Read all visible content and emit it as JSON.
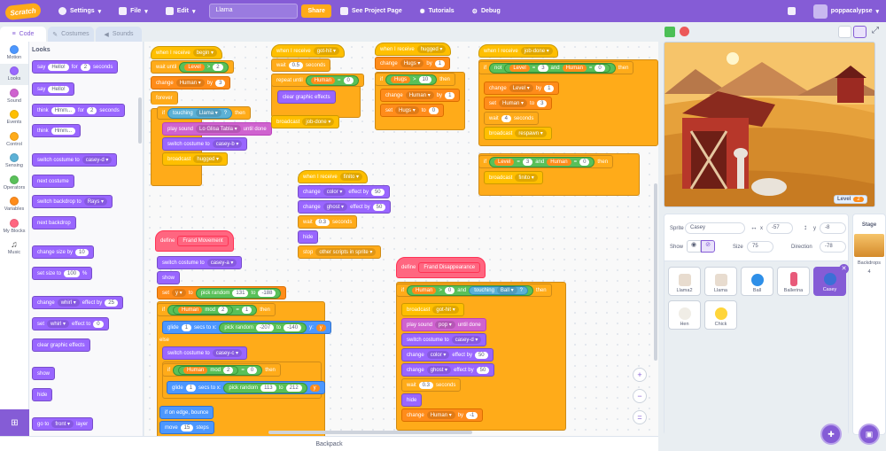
{
  "menubar": {
    "logo": "Scratch",
    "settings": "Settings",
    "file": "File",
    "edit": "Edit",
    "project_title": "Llama",
    "share": "Share",
    "see_project": "See Project Page",
    "tutorials": "Tutorials",
    "debug": "Debug",
    "username": "poppacalypse"
  },
  "tabs": {
    "code": "Code",
    "costumes": "Costumes",
    "sounds": "Sounds"
  },
  "categories": [
    {
      "label": "Motion",
      "color": "#4c97ff"
    },
    {
      "label": "Looks",
      "color": "#9966ff"
    },
    {
      "label": "Sound",
      "color": "#cf63cf"
    },
    {
      "label": "Events",
      "color": "#ffbf00"
    },
    {
      "label": "Control",
      "color": "#ffab19"
    },
    {
      "label": "Sensing",
      "color": "#5cb1d6"
    },
    {
      "label": "Operators",
      "color": "#59c059"
    },
    {
      "label": "Variables",
      "color": "#ff8c1a"
    },
    {
      "label": "My Blocks",
      "color": "#ff6680"
    },
    {
      "label": "Music",
      "color": "#444444"
    }
  ],
  "palette": {
    "heading": "Looks",
    "say": "say",
    "hello": "Hello!",
    "for": "for",
    "two": "2",
    "seconds": "seconds",
    "think": "think",
    "hmm": "Hmm...",
    "switch_costume_to": "switch costume to",
    "costume_casey_d": "casey-d",
    "next_costume": "next costume",
    "switch_backdrop_to": "switch backdrop to",
    "rays": "Rays",
    "next_backdrop": "next backdrop",
    "change_size_by": "change size by",
    "ten": "10",
    "set_size_to": "set size to",
    "hundred": "100",
    "percent": "%",
    "change": "change",
    "whirl": "whirl",
    "effect_by": "effect by",
    "twentyfive": "25",
    "set": "set",
    "effect_to": "effect to",
    "zero": "0",
    "clear_graphic_effects": "clear graphic effects",
    "show": "show",
    "hide": "hide",
    "go_to": "go to",
    "front": "front",
    "layer": "layer"
  },
  "scripts": {
    "s1": {
      "when_i_receive": "when I receive",
      "begin": "begin",
      "wait_until": "wait until",
      "level": "Level",
      "gt": ">",
      "two": "2",
      "change": "change",
      "human": "Human",
      "by": "by",
      "three": "3",
      "forever": "forever",
      "if": "if",
      "touching": "touching",
      "llama": "Llama",
      "q": "?",
      "then": "then",
      "play_sound": "play sound",
      "sound_name": "Lo Glisa Tabla",
      "until_done": "until done",
      "switch_costume_to": "switch costume to",
      "casey_b": "casey-b",
      "broadcast": "broadcast",
      "hugged": "hugged"
    },
    "s2": {
      "when_i_receive": "when I receive",
      "got_hit": "got-hit",
      "wait": "wait",
      "half": "0.5",
      "seconds": "seconds",
      "repeat_until": "repeat until",
      "human": "Human",
      "eq": "=",
      "zero": "0",
      "clear": "clear graphic effects",
      "broadcast": "broadcast",
      "job_done": "job-done"
    },
    "s3": {
      "when_i_receive": "when I receive",
      "hugged": "hugged",
      "change": "change",
      "hugs": "Hugs",
      "by": "by",
      "one": "1",
      "if": "if",
      "gt": ">",
      "ten": "10",
      "then": "then",
      "human": "Human",
      "set": "set",
      "to": "to",
      "zero": "0"
    },
    "s4": {
      "when_i_receive": "when I receive",
      "job_done": "job-done",
      "if": "if",
      "not": "not",
      "level": "Level",
      "eq": "=",
      "three": "3",
      "and": "and",
      "human": "Human",
      "zero": "0",
      "then": "then",
      "change": "change",
      "by": "by",
      "one": "1",
      "set": "set",
      "to": "to",
      "wait": "wait",
      "four": "4",
      "seconds": "seconds",
      "broadcast": "broadcast",
      "respawn": "respawn",
      "finito": "finito"
    },
    "s5": {
      "when_i_receive": "when I receive",
      "finito": "finito",
      "change": "change",
      "color": "color",
      "ghost": "ghost",
      "effect_by": "effect by",
      "fifty": "50",
      "wait": "wait",
      "t03": "0.3",
      "seconds": "seconds",
      "hide": "hide",
      "stop": "stop",
      "other_scripts": "other scripts in sprite"
    },
    "s6": {
      "define": "define",
      "name": "Frand Movement",
      "switch_costume_to": "switch costume to",
      "casey_a": "casey-a",
      "show": "show",
      "set": "set",
      "y": "y",
      "to": "to",
      "pick_random": "pick random",
      "n131": "131",
      "n188": "-188",
      "if": "if",
      "human": "Human",
      "mod": "mod",
      "two": "2",
      "eq": "=",
      "one": "1",
      "then": "then",
      "glide": "glide",
      "secs_to_x": "secs to x:",
      "n207": "-207",
      "n140": "-140",
      "ylab": "y:",
      "else": "else",
      "casey_c": "casey-c",
      "zero": "0",
      "n113": "113",
      "n212": "212",
      "bounce": "if on edge, bounce",
      "move": "move",
      "fifteen": "15",
      "steps": "steps"
    },
    "s7": {
      "define": "define",
      "name": "Frand Disappearance",
      "if": "if",
      "human": "Human",
      "gt": ">",
      "zero": "0",
      "and": "and",
      "touching": "touching",
      "ball": "Ball",
      "q": "?",
      "then": "then",
      "broadcast": "broadcast",
      "got_hit": "got-hit",
      "play_sound": "play sound",
      "pop": "pop",
      "until_done": "until done",
      "switch_costume_to": "switch costume to",
      "casey_d": "casey-d",
      "change": "change",
      "color": "color",
      "ghost": "ghost",
      "effect_by": "effect by",
      "fifty": "50",
      "wait": "wait",
      "t03": "0.3",
      "seconds": "seconds",
      "hide": "hide",
      "by": "by",
      "m1": "-1"
    }
  },
  "workspace": {
    "zoom_in": "+",
    "zoom_out": "−",
    "reset": "="
  },
  "backpack": "Backpack",
  "stage": {
    "level_label": "Level",
    "level_value": "2"
  },
  "sprite_info": {
    "sprite_label": "Sprite",
    "sprite_name": "Casey",
    "x": "-57",
    "y": "-8",
    "show_label": "Show",
    "size_label": "Size",
    "size_value": "75",
    "direction_label": "Direction",
    "direction_value": "-78",
    "x_label": "x",
    "y_label": "y"
  },
  "sprites": [
    "Llama2",
    "Llama",
    "Ball",
    "Ballerina",
    "Casey",
    "Hen",
    "Chick"
  ],
  "stage_panel": {
    "title": "Stage",
    "backdrops_label": "Backdrops",
    "backdrops_count": "4"
  }
}
